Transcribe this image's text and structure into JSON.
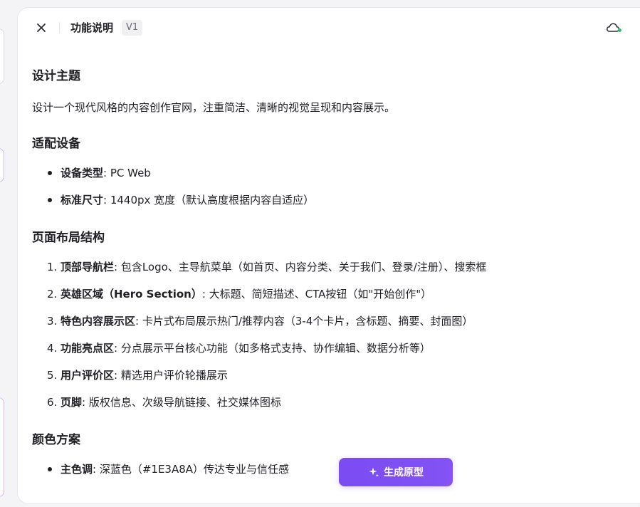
{
  "header": {
    "title": "功能说明",
    "version": "V1"
  },
  "sections": {
    "design": {
      "title": "设计主题",
      "text": "设计一个现代风格的内容创作官网，注重简洁、清晰的视觉呈现和内容展示。"
    },
    "device": {
      "title": "适配设备",
      "items": [
        {
          "label": "设备类型",
          "text": ": PC Web"
        },
        {
          "label": "标准尺寸",
          "text": ": 1440px 宽度（默认高度根据内容自适应）"
        }
      ]
    },
    "layout": {
      "title": "页面布局结构",
      "items": [
        {
          "num": "1.",
          "label": "顶部导航栏",
          "text": ": 包含Logo、主导航菜单（如首页、内容分类、关于我们、登录/注册）、搜索框"
        },
        {
          "num": "2.",
          "label": "英雄区域（Hero Section）",
          "text": ": 大标题、简短描述、CTA按钮（如\"开始创作\"）"
        },
        {
          "num": "3.",
          "label": "特色内容展示区",
          "text": ": 卡片式布局展示热门/推荐内容（3-4个卡片，含标题、摘要、封面图）"
        },
        {
          "num": "4.",
          "label": "功能亮点区",
          "text": ": 分点展示平台核心功能（如多格式支持、协作编辑、数据分析等）"
        },
        {
          "num": "5.",
          "label": "用户评价区",
          "text": ": 精选用户评价轮播展示"
        },
        {
          "num": "6.",
          "label": "页脚",
          "text": ": 版权信息、次级导航链接、社交媒体图标"
        }
      ]
    },
    "color": {
      "title": "颜色方案",
      "items": [
        {
          "label": "主色调",
          "text": ": 深蓝色（#1E3A8A）传达专业与信任感"
        }
      ]
    }
  },
  "actions": {
    "generate_label": "生成原型"
  },
  "colors": {
    "accent": "#7C4DFF",
    "status_dot": "#22C55E"
  },
  "icons": {
    "close": "close-icon",
    "cloud": "cloud-sync-icon",
    "sparkle": "sparkle-icon"
  }
}
